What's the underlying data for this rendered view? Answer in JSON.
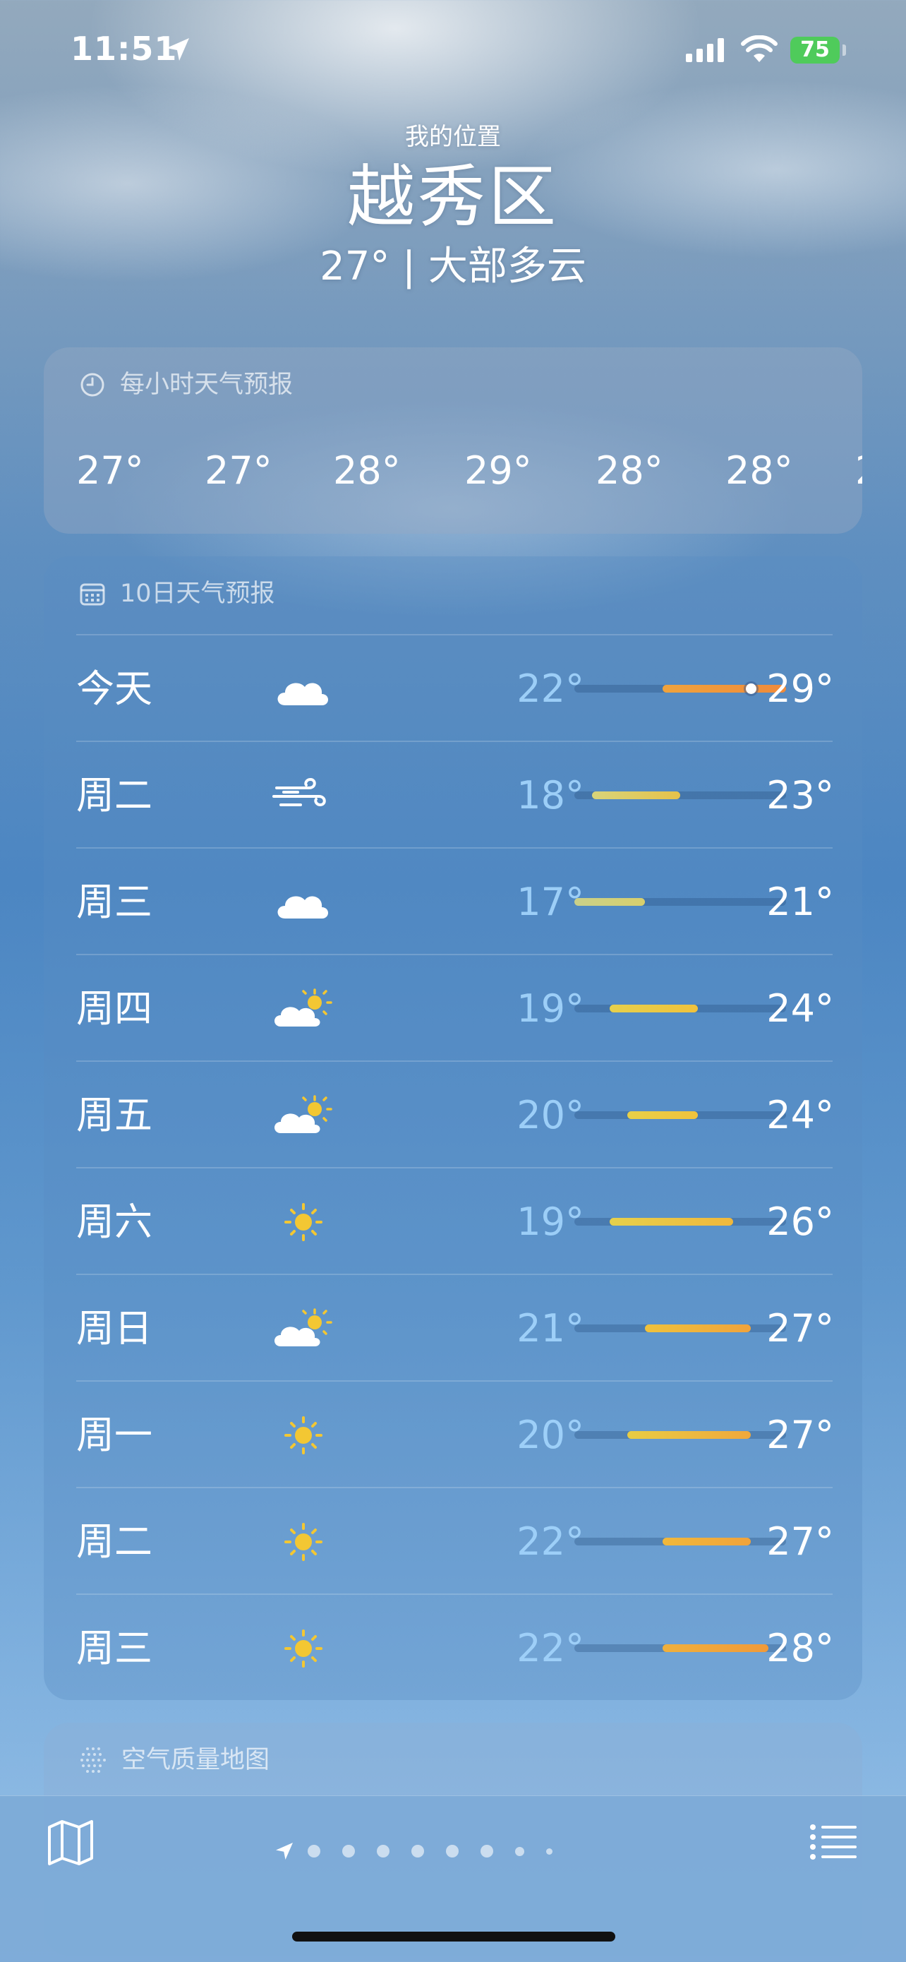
{
  "status": {
    "time": "11:51",
    "battery": "75"
  },
  "header": {
    "location_label": "我的位置",
    "city": "越秀区",
    "current": "27° | 大部多云"
  },
  "hourly": {
    "title": "每小时天气预报",
    "temps": [
      "27°",
      "27°",
      "28°",
      "29°",
      "28°",
      "28°",
      "2"
    ]
  },
  "daily": {
    "title": "10日天气预报",
    "scale_min": 17,
    "scale_max": 29,
    "days": [
      {
        "name": "今天",
        "icon": "cloud",
        "low": "22°",
        "high": "29°",
        "low_val": 22,
        "high_val": 29,
        "current_val": 27,
        "fill": "linear-gradient(90deg,#f0a33c,#f08a3a)"
      },
      {
        "name": "周二",
        "icon": "wind",
        "low": "18°",
        "high": "23°",
        "low_val": 18,
        "high_val": 23,
        "fill": "linear-gradient(90deg,#d8d47a,#e6c24a)"
      },
      {
        "name": "周三",
        "icon": "cloud",
        "low": "17°",
        "high": "21°",
        "low_val": 17,
        "high_val": 21,
        "fill": "linear-gradient(90deg,#c9d08a,#d8cf6c)"
      },
      {
        "name": "周四",
        "icon": "partly-sunny",
        "low": "19°",
        "high": "24°",
        "low_val": 19,
        "high_val": 24,
        "fill": "linear-gradient(90deg,#e6d04c,#f0c23c)"
      },
      {
        "name": "周五",
        "icon": "partly-sunny",
        "low": "20°",
        "high": "24°",
        "low_val": 20,
        "high_val": 24,
        "fill": "linear-gradient(90deg,#e8d048,#f0c23c)"
      },
      {
        "name": "周六",
        "icon": "sun",
        "low": "19°",
        "high": "26°",
        "low_val": 19,
        "high_val": 26,
        "fill": "linear-gradient(90deg,#e6d04c,#f0b83c)"
      },
      {
        "name": "周日",
        "icon": "partly-sunny",
        "low": "21°",
        "high": "27°",
        "low_val": 21,
        "high_val": 27,
        "fill": "linear-gradient(90deg,#f0c23c,#f0a33c)"
      },
      {
        "name": "周一",
        "icon": "sun",
        "low": "20°",
        "high": "27°",
        "low_val": 20,
        "high_val": 27,
        "fill": "linear-gradient(90deg,#e8cc44,#f0a83c)"
      },
      {
        "name": "周二",
        "icon": "sun",
        "low": "22°",
        "high": "27°",
        "low_val": 22,
        "high_val": 27,
        "fill": "linear-gradient(90deg,#f0b83c,#f0a33c)"
      },
      {
        "name": "周三",
        "icon": "sun",
        "low": "22°",
        "high": "28°",
        "low_val": 22,
        "high_val": 28,
        "fill": "linear-gradient(90deg,#f0b03c,#f09a3a)"
      }
    ]
  },
  "air_quality": {
    "title": "空气质量地图"
  },
  "pager": {
    "page_count": 9,
    "active_index": 0
  }
}
